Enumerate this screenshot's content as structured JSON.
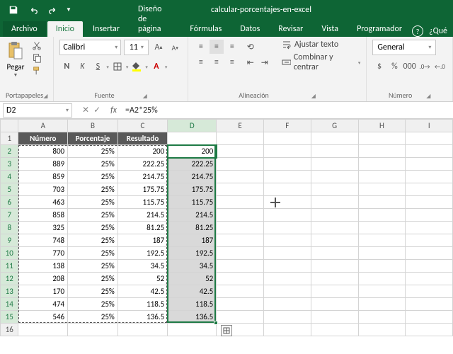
{
  "titlebar": {
    "doc_title": "calcular-porcentajes-en-excel"
  },
  "tabs": {
    "file": "Archivo",
    "items": [
      "Inicio",
      "Insertar",
      "Diseño de página",
      "Fórmulas",
      "Datos",
      "Revisar",
      "Vista",
      "Programador"
    ],
    "help_prompt": "¿Qué"
  },
  "ribbon": {
    "clipboard": {
      "paste": "Pegar",
      "group": "Portapapeles"
    },
    "font": {
      "name": "Calibri",
      "size": "11",
      "group": "Fuente",
      "bold": "N",
      "italic": "K",
      "underline": "S"
    },
    "align": {
      "group": "Alineación",
      "wrap": "Ajustar texto",
      "merge": "Combinar y centrar"
    },
    "number": {
      "group": "Número",
      "format": "General"
    }
  },
  "namebox": "D2",
  "formula": "=A2*25%",
  "columns": [
    "A",
    "B",
    "C",
    "D",
    "E",
    "F",
    "G",
    "H",
    "I"
  ],
  "headers": [
    "Número",
    "Porcentaje",
    "Resultado"
  ],
  "rows": [
    {
      "n": 800,
      "p": "25%",
      "r": "200",
      "d": "200"
    },
    {
      "n": 889,
      "p": "25%",
      "r": "222.25",
      "d": "222.25"
    },
    {
      "n": 859,
      "p": "25%",
      "r": "214.75",
      "d": "214.75"
    },
    {
      "n": 703,
      "p": "25%",
      "r": "175.75",
      "d": "175.75"
    },
    {
      "n": 463,
      "p": "25%",
      "r": "115.75",
      "d": "115.75"
    },
    {
      "n": 858,
      "p": "25%",
      "r": "214.5",
      "d": "214.5"
    },
    {
      "n": 325,
      "p": "25%",
      "r": "81.25",
      "d": "81.25"
    },
    {
      "n": 748,
      "p": "25%",
      "r": "187",
      "d": "187"
    },
    {
      "n": 770,
      "p": "25%",
      "r": "192.5",
      "d": "192.5"
    },
    {
      "n": 138,
      "p": "25%",
      "r": "34.5",
      "d": "34.5"
    },
    {
      "n": 208,
      "p": "25%",
      "r": "52",
      "d": "52"
    },
    {
      "n": 170,
      "p": "25%",
      "r": "42.5",
      "d": "42.5"
    },
    {
      "n": 474,
      "p": "25%",
      "r": "118.5",
      "d": "118.5"
    },
    {
      "n": 546,
      "p": "25%",
      "r": "136.5",
      "d": "136.5"
    }
  ],
  "chart_data": {
    "type": "table",
    "title": "calcular-porcentajes-en-excel",
    "columns": [
      "Número",
      "Porcentaje",
      "Resultado",
      "D"
    ],
    "data": [
      [
        800,
        0.25,
        200,
        200
      ],
      [
        889,
        0.25,
        222.25,
        222.25
      ],
      [
        859,
        0.25,
        214.75,
        214.75
      ],
      [
        703,
        0.25,
        175.75,
        175.75
      ],
      [
        463,
        0.25,
        115.75,
        115.75
      ],
      [
        858,
        0.25,
        214.5,
        214.5
      ],
      [
        325,
        0.25,
        81.25,
        81.25
      ],
      [
        748,
        0.25,
        187,
        187
      ],
      [
        770,
        0.25,
        192.5,
        192.5
      ],
      [
        138,
        0.25,
        34.5,
        34.5
      ],
      [
        208,
        0.25,
        52,
        52
      ],
      [
        170,
        0.25,
        42.5,
        42.5
      ],
      [
        474,
        0.25,
        118.5,
        118.5
      ],
      [
        546,
        0.25,
        136.5,
        136.5
      ]
    ],
    "formula_D": "=A{r}*25%"
  }
}
